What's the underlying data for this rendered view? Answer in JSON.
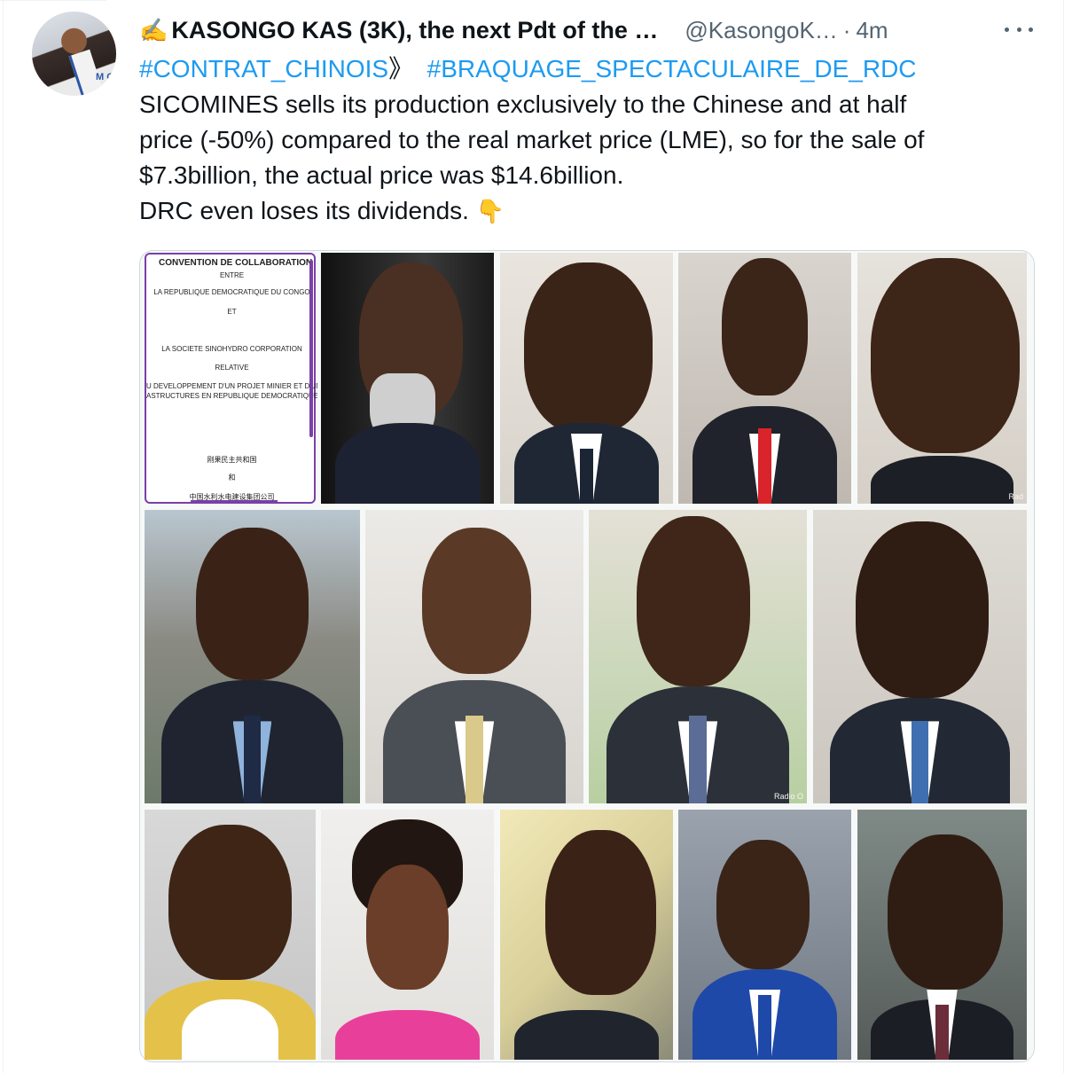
{
  "tweet": {
    "author": {
      "emoji": "✍️",
      "display_name": "KASONGO KAS (3K), the next Pdt of the …",
      "handle": "@KasongoK…",
      "separator": "·",
      "timestamp": "4m",
      "avatar_sash_text": "M C"
    },
    "hashtags": {
      "first": "#CONTRAT_CHINOIS",
      "arrow": "》",
      "second": "#BRAQUAGE_SPECTACULAIRE_DE_RDC"
    },
    "body_lines": [
      "SICOMINES sells its production exclusively to the Chinese and at half",
      "price (-50%) compared to the real market price (LME), so for the sale of",
      "$7.3billion, the actual price was $14.6billion.",
      "DRC even loses its dividends."
    ],
    "pointer_emoji": "👇"
  },
  "media": {
    "document": {
      "lines": [
        "CONVENTION DE COLLABORATION",
        "ENTRE",
        "LA REPUBLIQUE DEMOCRATIQUE DU CONGO",
        "ET",
        "LA SOCIETE SINOHYDRO CORPORATION",
        "RELATIVE",
        "U DEVELOPPEMENT D'UN PROJET MINIER ET D'UN P",
        "ASTRUCTURES EN REPUBLIQUE DEMOCRATIQUE DU",
        "刚果民主共和国",
        "和",
        "中国水利水电建设集团公司"
      ]
    },
    "captions": {
      "row1_last": "Rad",
      "row2_third": "Radio O"
    }
  },
  "colors": {
    "link": "#1d9bf0",
    "secondary_text": "#536471",
    "doc_border": "#7a3fa8"
  },
  "icons": {
    "more": "more-horizontal-icon",
    "pointer": "backhand-index-pointing-down-icon"
  }
}
